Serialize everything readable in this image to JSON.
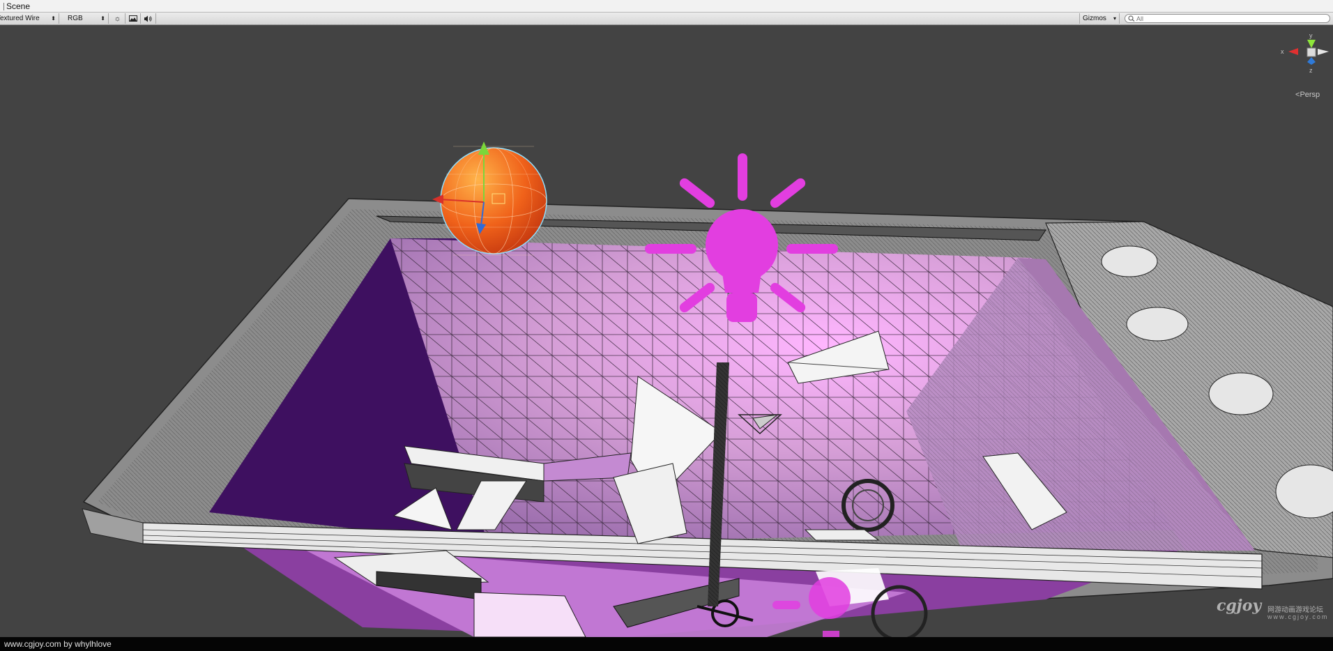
{
  "window": {
    "tab_title": "Scene"
  },
  "toolbar": {
    "render_mode": "Textured Wire",
    "color_mode": "RGB",
    "gizmos_label": "Gizmos",
    "search_placeholder": "All"
  },
  "viewport": {
    "projection_label": "Persp",
    "axis_labels": {
      "y": "y",
      "x": "x",
      "z": "z"
    },
    "scene_objects": [
      "point-light-gizmo",
      "selected-sphere",
      "room-wireframe"
    ],
    "colors": {
      "background": "#434343",
      "light_gizmo": "#e23ee0",
      "sphere": "#f26a1a",
      "room_inner": "#c9a0cc",
      "room_dark": "#3e1060",
      "frame": "#9c9c9c"
    }
  },
  "footer": {
    "credit": "www.cgjoy.com by whylhlove"
  },
  "watermark": {
    "logo": "cgjoy",
    "subtitle": "网游动画游戏论坛",
    "url": "www.cgjoy.com"
  }
}
